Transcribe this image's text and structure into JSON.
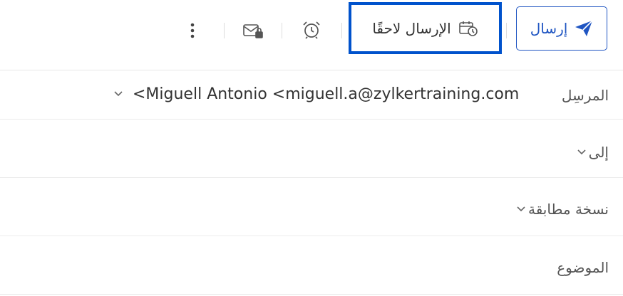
{
  "toolbar": {
    "send_label": "إرسال",
    "send_later_label": "الإرسال لاحقًا"
  },
  "fields": {
    "from_label": "المرسِل",
    "from_value": "<Miguell Antonio <miguell.a@zylkertraining.com",
    "to_label": "إلى",
    "cc_label": "نسخة مطابقة",
    "subject_label": "الموضوع"
  },
  "icons": {
    "send": "paper-plane-icon",
    "send_later": "calendar-clock-icon",
    "reminder": "alarm-clock-icon",
    "secure_mail": "envelope-lock-icon",
    "more": "more-vertical-icon",
    "chevron": "chevron-down-icon"
  },
  "colors": {
    "accent": "#1f55c2",
    "highlight_border": "#0052cc"
  }
}
